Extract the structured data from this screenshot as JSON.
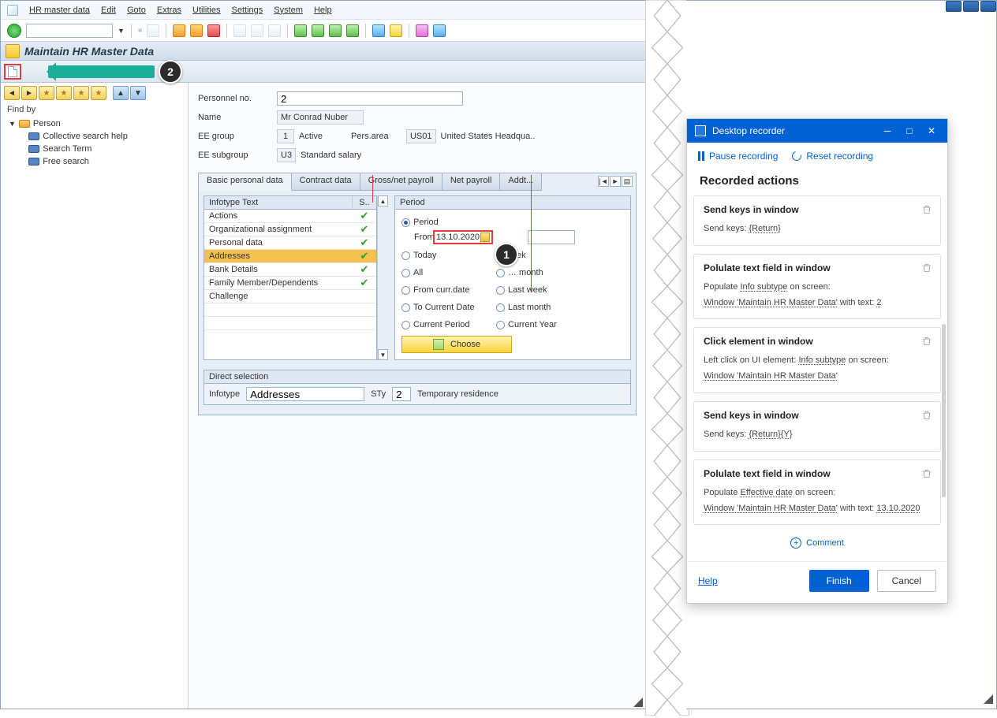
{
  "menubar": [
    "HR master data",
    "Edit",
    "Goto",
    "Extras",
    "Utilities",
    "Settings",
    "System",
    "Help"
  ],
  "title": "Maintain HR Master Data",
  "annotations": {
    "badge1": "1",
    "badge2": "2"
  },
  "sidebar": {
    "findby": "Find by",
    "root": "Person",
    "items": [
      "Collective search help",
      "Search Term",
      "Free search"
    ]
  },
  "header": {
    "personnel_no_label": "Personnel no.",
    "personnel_no": "2",
    "name_label": "Name",
    "name": "Mr Conrad Nuber",
    "ee_group_label": "EE group",
    "ee_group_code": "1",
    "ee_group_text": "Active",
    "pers_area_label": "Pers.area",
    "pers_area_code": "US01",
    "pers_area_text": "United States Headqua..",
    "ee_subgroup_label": "EE subgroup",
    "ee_subgroup_code": "U3",
    "ee_subgroup_text": "Standard salary"
  },
  "tabs": [
    "Basic personal data",
    "Contract data",
    "Gross/net payroll",
    "Net payroll",
    "Addt..."
  ],
  "active_tab": 0,
  "infotype_header": {
    "c1": "Infotype Text",
    "c2": "S.."
  },
  "infotypes": [
    {
      "text": "Actions",
      "checked": true
    },
    {
      "text": "Organizational assignment",
      "checked": true
    },
    {
      "text": "Personal data",
      "checked": true
    },
    {
      "text": "Addresses",
      "checked": true,
      "selected": true
    },
    {
      "text": "Bank Details",
      "checked": true
    },
    {
      "text": "Family Member/Dependents",
      "checked": true
    },
    {
      "text": "Challenge",
      "checked": false
    }
  ],
  "period": {
    "title": "Period",
    "period_label": "Period",
    "from_label": "From",
    "from_value": "13.10.2020",
    "to_value": "",
    "options_left": [
      "Today",
      "All",
      "From curr.date",
      "To Current Date",
      "Current Period"
    ],
    "options_right": [
      "Curr.week",
      "Current month",
      "Last week",
      "Last month",
      "Current Year"
    ],
    "choose": "Choose"
  },
  "direct_selection": {
    "title": "Direct selection",
    "infotype_label": "Infotype",
    "infotype_value": "Addresses",
    "sty_label": "STy",
    "sty_value": "2",
    "sty_text": "Temporary residence"
  },
  "recorder": {
    "title": "Desktop recorder",
    "pause": "Pause recording",
    "reset": "Reset recording",
    "heading": "Recorded actions",
    "actions": [
      {
        "title": "Send keys in window",
        "lines": [
          [
            "Send keys: ",
            [
              "{Return}",
              true
            ]
          ]
        ]
      },
      {
        "title": "Polulate text field in window",
        "lines": [
          [
            "Populate ",
            [
              "Info subtype",
              true
            ],
            " on screen:"
          ],
          [
            [
              "Window 'Maintain HR Master Data'",
              true
            ],
            " with text: ",
            [
              "2",
              true
            ]
          ]
        ]
      },
      {
        "title": "Click element in window",
        "lines": [
          [
            "Left click on UI element: ",
            [
              "Info subtype",
              true
            ],
            " on screen:"
          ],
          [
            [
              "Window 'Maintain HR Master Data'",
              true
            ]
          ]
        ]
      },
      {
        "title": "Send keys in window",
        "lines": [
          [
            "Send keys: ",
            [
              "{Return}{Y}",
              true
            ]
          ]
        ]
      },
      {
        "title": "Polulate text field in window",
        "lines": [
          [
            "Populate ",
            [
              "Effective date",
              true
            ],
            " on screen:"
          ],
          [
            [
              "Window 'Maintain HR Master Data'",
              true
            ],
            " with text: ",
            [
              "13.10.2020",
              true
            ]
          ]
        ]
      }
    ],
    "comment": "Comment",
    "help": "Help",
    "finish": "Finish",
    "cancel": "Cancel"
  }
}
